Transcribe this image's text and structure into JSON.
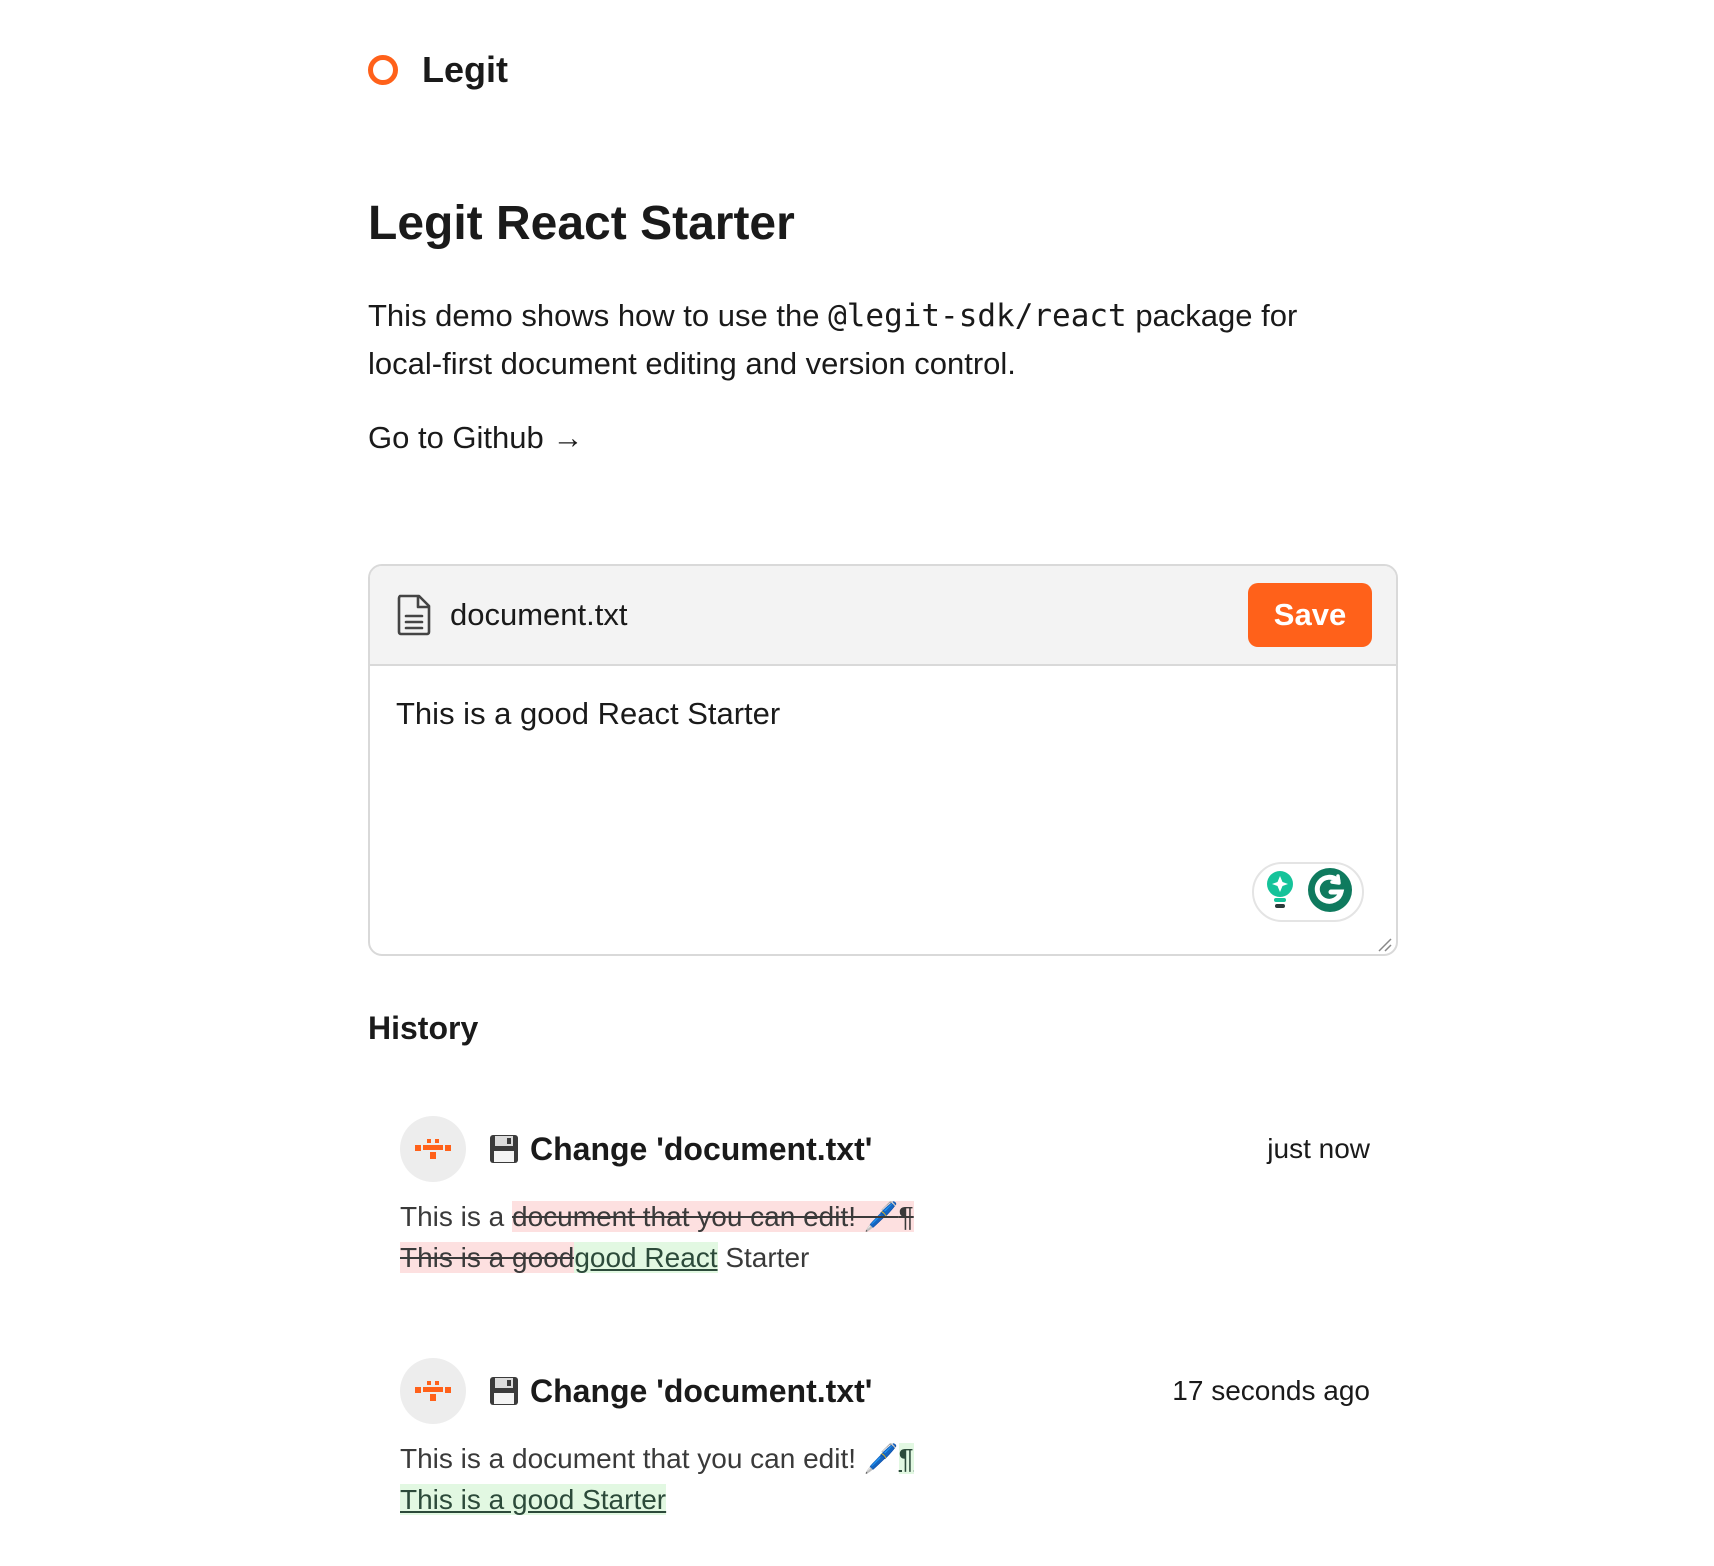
{
  "brand": {
    "name": "Legit"
  },
  "hero": {
    "title": "Legit React Starter",
    "intro_before": "This demo shows how to use the ",
    "intro_code": "@legit-sdk/react",
    "intro_after": " package for local-first document editing and version control.",
    "github_link": "Go to Github →"
  },
  "editor": {
    "file_name": "document.txt",
    "save_label": "Save",
    "content": "This is a good React Starter"
  },
  "history": {
    "heading": "History",
    "items": [
      {
        "title": "Change 'document.txt'",
        "time": "just now",
        "line1_plain": "This is a ",
        "line1_del": "document that you can edit! 🖊️",
        "line1_del_mark": "¶",
        "line2_del": "This is a good",
        "line2_ins": "good React",
        "line2_plain": " Starter"
      },
      {
        "title": "Change 'document.txt'",
        "time": "17 seconds ago",
        "line1_plain": "This is a document that you can edit! 🖊️",
        "line1_ins_mark": "¶",
        "line2_ins": "This is a good Starter"
      }
    ]
  },
  "colors": {
    "accent": "#ff611a",
    "deleted_bg": "#fde0e0",
    "inserted_bg": "#e2f8e2",
    "grammarly": "#15c39a"
  },
  "icons": {
    "brand": "ring-logo-icon",
    "file": "document-file-icon",
    "history_entry": "floppy-disk-icon",
    "avatar": "pixel-avatar-icon",
    "assistant": "lightbulb-icon",
    "grammarly": "grammarly-g-icon"
  }
}
